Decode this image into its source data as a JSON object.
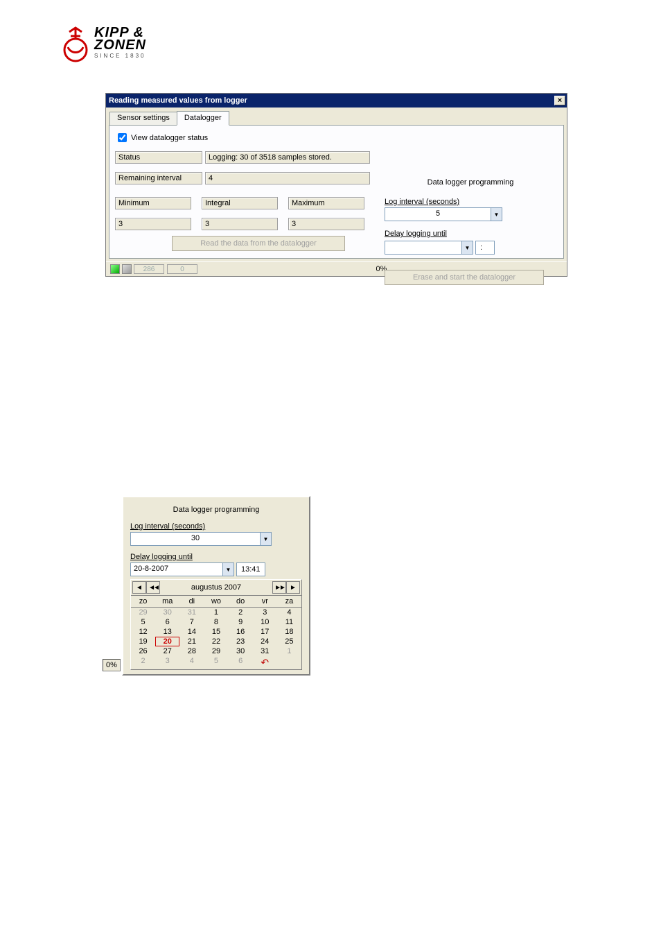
{
  "brand": {
    "line1": "KIPP &",
    "line2": "ZONEN",
    "tagline": "SINCE 1830"
  },
  "dialog": {
    "title": "Reading measured values from logger",
    "tabs": {
      "sensor": "Sensor settings",
      "datalogger": "Datalogger"
    },
    "view_status_label": "View datalogger status",
    "view_status_checked": true,
    "status_label": "Status",
    "status_value": "Logging: 30 of 3518 samples stored.",
    "remaining_label": "Remaining interval",
    "remaining_value": "4",
    "min_label": "Minimum",
    "min_value": "3",
    "int_label": "Integral",
    "int_value": "3",
    "max_label": "Maximum",
    "max_value": "3",
    "read_button": "Read the data from the datalogger",
    "right": {
      "heading": "Data logger programming",
      "log_interval_label": "Log interval (seconds)",
      "log_interval_value": "5",
      "delay_label": "Delay logging until",
      "delay_date": "",
      "delay_time": ":",
      "erase_button": "Erase and start the datalogger"
    }
  },
  "bottom": {
    "num1": "286",
    "num2": "0",
    "pct": "0%"
  },
  "popup": {
    "heading": "Data logger programming",
    "log_interval_label": "Log interval (seconds)",
    "log_interval_value": "30",
    "delay_label": "Delay logging until",
    "delay_date": "20-8-2007",
    "delay_time": "13:41",
    "pct": "0%",
    "calendar": {
      "month_label": "augustus 2007",
      "dow": [
        "zo",
        "ma",
        "di",
        "wo",
        "do",
        "vr",
        "za"
      ],
      "rows": [
        [
          {
            "d": "29",
            "o": true
          },
          {
            "d": "30",
            "o": true
          },
          {
            "d": "31",
            "o": true
          },
          {
            "d": "1"
          },
          {
            "d": "2"
          },
          {
            "d": "3"
          },
          {
            "d": "4"
          }
        ],
        [
          {
            "d": "5"
          },
          {
            "d": "6"
          },
          {
            "d": "7"
          },
          {
            "d": "8"
          },
          {
            "d": "9"
          },
          {
            "d": "10"
          },
          {
            "d": "11"
          }
        ],
        [
          {
            "d": "12"
          },
          {
            "d": "13"
          },
          {
            "d": "14"
          },
          {
            "d": "15"
          },
          {
            "d": "16"
          },
          {
            "d": "17"
          },
          {
            "d": "18"
          }
        ],
        [
          {
            "d": "19"
          },
          {
            "d": "20",
            "sel": true
          },
          {
            "d": "21"
          },
          {
            "d": "22"
          },
          {
            "d": "23"
          },
          {
            "d": "24"
          },
          {
            "d": "25"
          }
        ],
        [
          {
            "d": "26"
          },
          {
            "d": "27"
          },
          {
            "d": "28"
          },
          {
            "d": "29"
          },
          {
            "d": "30"
          },
          {
            "d": "31"
          },
          {
            "d": "1",
            "o": true
          }
        ],
        [
          {
            "d": "2",
            "o": true
          },
          {
            "d": "3",
            "o": true
          },
          {
            "d": "4",
            "o": true
          },
          {
            "d": "5",
            "o": true
          },
          {
            "d": "6",
            "o": true
          },
          {
            "d": "",
            "today": true
          },
          {
            "d": ""
          }
        ]
      ]
    }
  }
}
